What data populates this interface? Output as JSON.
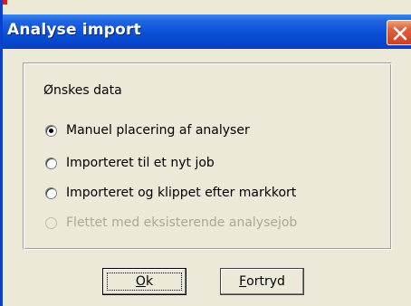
{
  "window": {
    "title": "Analyse import",
    "titlebar_color": "#0a50d8",
    "close_button_color": "#d04020"
  },
  "group": {
    "label": "Ønskes data",
    "options": [
      {
        "label": "Manuel placering af analyser",
        "checked": true,
        "enabled": true
      },
      {
        "label": "Importeret til et nyt job",
        "checked": false,
        "enabled": true
      },
      {
        "label": "Importeret og klippet efter markkort",
        "checked": false,
        "enabled": true
      },
      {
        "label": "Flettet med eksisterende analysejob",
        "checked": false,
        "enabled": false
      }
    ]
  },
  "buttons": {
    "ok_accel": "O",
    "ok_rest": "k",
    "cancel_accel": "F",
    "cancel_rest": "ortryd"
  }
}
